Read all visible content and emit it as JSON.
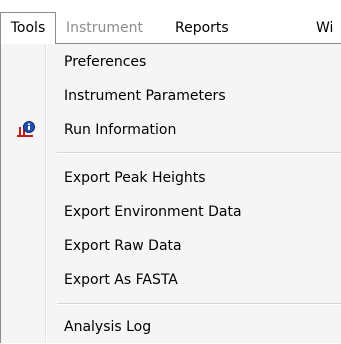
{
  "menubar": {
    "tools": "Tools",
    "instrument": "Instrument",
    "reports": "Reports",
    "window": "Wi"
  },
  "tools_menu": {
    "items": [
      {
        "label": "Preferences"
      },
      {
        "label": "Instrument Parameters"
      },
      {
        "label": "Run Information",
        "icon": "run-information-icon"
      },
      {
        "label": "Export Peak Heights"
      },
      {
        "label": "Export Environment Data"
      },
      {
        "label": "Export Raw Data"
      },
      {
        "label": "Export As FASTA"
      },
      {
        "label": "Analysis Log"
      }
    ]
  },
  "colors": {
    "menu_background": "#f5f5f5",
    "disabled_text": "#8d8d8d",
    "border": "#8c8c8c",
    "icon_red": "#c41a1a",
    "icon_blue": "#1f4fb0"
  }
}
